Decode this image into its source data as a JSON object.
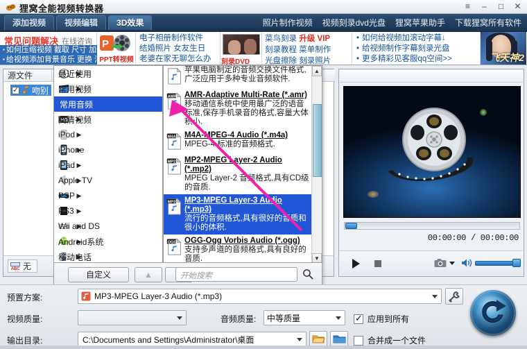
{
  "window": {
    "title": "狸窝全能视频转换器",
    "icon": "app-logo-icon",
    "buttons": {
      "menu": "≡",
      "minimize": "–",
      "maximize": "□",
      "close": "✕"
    }
  },
  "tabs": [
    {
      "label": "添加视频",
      "active": false
    },
    {
      "label": "视频编辑",
      "active": false
    },
    {
      "label": "3D效果",
      "active": true
    }
  ],
  "top_links": [
    "照片制作视频",
    "视频刻录dvd光盘",
    "狸窝苹果助手",
    "下载狸窝所有软件"
  ],
  "banner": {
    "faq": {
      "title": "常见问题解决",
      "consult": "在线咨询",
      "rows": [
        "如何压缩视频 截取 尺寸 加速",
        "给视频添加背景音乐 更换 消音"
      ]
    },
    "ppt": {
      "caption": "PPT转视频"
    },
    "links1": [
      "电子相册制作软件",
      "结婚照片 女友生日",
      "老婆在家无聊怎么办"
    ],
    "dvd": {
      "caption": "刻录DVD"
    },
    "links2": [
      {
        "blue": "菜鸟刻录",
        "red": "升级 VIP"
      },
      {
        "blue": "刻录教程 菜单制作",
        "red": ""
      },
      {
        "blue": "光盘擦除 刻录照片",
        "red": ""
      }
    ],
    "links3": [
      "如何给视频加滚动字幕↓",
      "给视频制作字幕刻录光盘",
      "更多精彩见客服qq空间>>"
    ],
    "game": {
      "caption": "飞天神2"
    }
  },
  "filelist": {
    "column_header": "源文件",
    "row": {
      "name": "吻别",
      "checked": true,
      "icon": "music-note-icon"
    },
    "subtitle_chip": {
      "icon": "abc-subtitle-icon",
      "label": "无"
    }
  },
  "menu": {
    "items": [
      {
        "label": "最近使用",
        "icon": "clock-icon",
        "selected": false
      },
      {
        "label": "常用视频",
        "icon": "video-icon",
        "selected": false
      },
      {
        "label": "常用音频",
        "icon": "audio-icon",
        "selected": true
      },
      {
        "label": "高清视频",
        "icon": "hd-icon",
        "selected": false
      },
      {
        "label": "iPod",
        "icon": "ipod-icon",
        "selected": false
      },
      {
        "label": "iPhone",
        "icon": "iphone-icon",
        "selected": false
      },
      {
        "label": "iPad",
        "icon": "ipad-icon",
        "selected": false
      },
      {
        "label": "Apple TV",
        "icon": "appletv-icon",
        "selected": false
      },
      {
        "label": "PSP",
        "icon": "psp-icon",
        "selected": false
      },
      {
        "label": "PS3",
        "icon": "ps3-icon",
        "selected": false
      },
      {
        "label": "Wii and DS",
        "icon": "wii-icon",
        "selected": false
      },
      {
        "label": "Android系统",
        "icon": "android-icon",
        "selected": false
      },
      {
        "label": "移动电话",
        "icon": "phone-icon",
        "selected": false
      }
    ],
    "arrow": "▶"
  },
  "submenu": {
    "formats": [
      {
        "name": "",
        "desc": "苹果电脑制定的音频交换文件格式,广泛应用于多种专业音频软件.",
        "badge": "",
        "selected": false
      },
      {
        "name": "AMR-Adaptive Multi-Rate (*.amr)",
        "desc": "移动通信系统中使用最广泛的语音标准,保存手机录音的格式,容量大体积小.",
        "badge": "AMR",
        "selected": false
      },
      {
        "name": "M4A-MPEG-4 Audio (*.m4a)",
        "desc": "MPEG-4 标准的音频格式.",
        "badge": "M4A",
        "selected": false
      },
      {
        "name": "MP2-MPEG Layer-2 Audio (*.mp2)",
        "desc": "MPEG Layer-2 音频格式,具有CD级的音质.",
        "badge": "MP2",
        "selected": false
      },
      {
        "name": "MP3-MPEG Layer-3 Audio (*.mp3)",
        "desc": "流行的音频格式,具有很好的音质和很小的体积.",
        "badge": "MP3",
        "selected": true
      },
      {
        "name": "OGG-Ogg Vorbis Audio (*.ogg)",
        "desc": "支持多声道的音频格式,具有良好的音质.",
        "badge": "OGG",
        "selected": false
      }
    ],
    "scroll_up": "▲",
    "scroll_down": "▼"
  },
  "menubar": {
    "custom_button": "自定义",
    "up_button": "▲",
    "down_button": "▼",
    "search_placeholder": "开始搜索",
    "search_icon": "search-icon"
  },
  "preview": {
    "time": "00:00:00 / 00:00:00",
    "controls": {
      "play": "play-icon",
      "stop": "stop-icon",
      "snapshot": "camera-icon",
      "snapshot_menu": "chevron-down-icon",
      "volume": "speaker-icon"
    }
  },
  "settings": {
    "preset_label": "预置方案:",
    "preset_value": "MP3-MPEG Layer-3 Audio (*.mp3)",
    "preset_icon": "music-file-icon",
    "preset_tools_icon": "wrench-icon",
    "video_quality_label": "视频质量:",
    "video_quality_value": "",
    "audio_quality_label": "音频质量:",
    "audio_quality_value": "中等质量",
    "output_label": "输出目录:",
    "output_value": "C:\\Documents and Settings\\Administrator\\桌面",
    "open_folder_icon": "open-folder-icon",
    "browse_folder_icon": "folder-icon",
    "apply_all": {
      "label": "应用到所有",
      "checked": true
    },
    "merge_one": {
      "label": "合并成一个文件",
      "checked": false
    },
    "convert_button": "convert-icon"
  },
  "colors": {
    "accent_blue": "#2157d6",
    "tabstrip": "#23405f",
    "banner_red": "#e8352a",
    "link_blue": "#14559c",
    "arrow_magenta": "#ee22aa"
  }
}
